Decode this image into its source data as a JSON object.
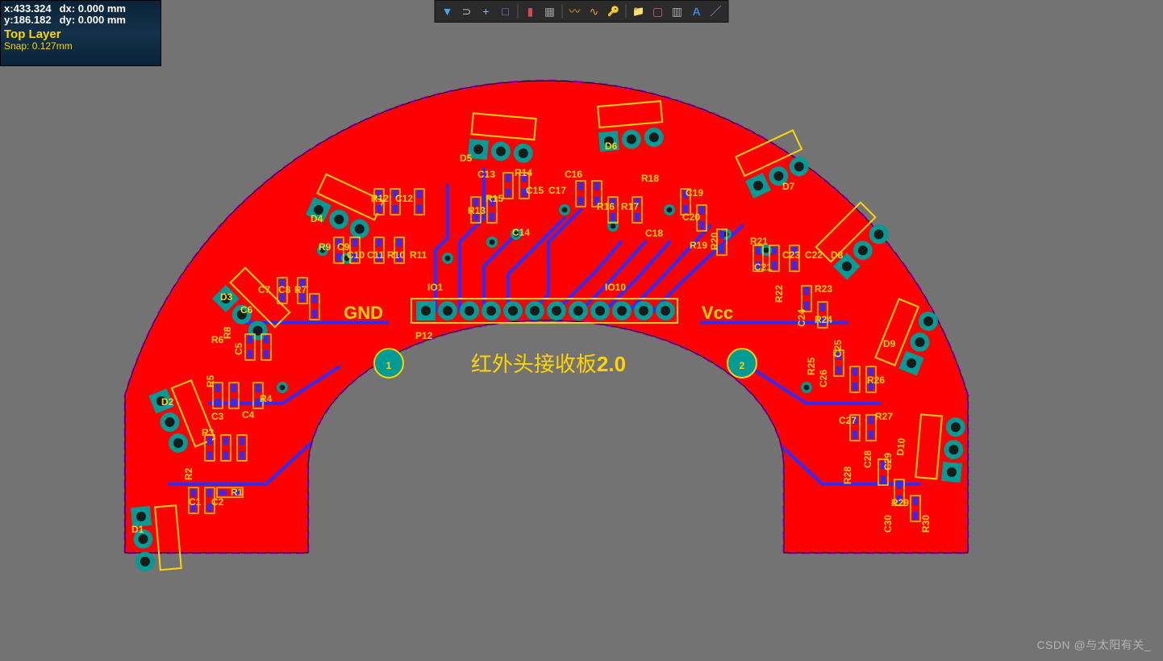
{
  "status": {
    "x_label": "x:",
    "x_val": "433.324",
    "dx_label": "dx:",
    "dx_val": "0.000 mm",
    "y_label": "y:",
    "y_val": "186.182",
    "dy_label": "dy:",
    "dy_val": "0.000 mm",
    "layer": "Top Layer",
    "snap": "Snap: 0.127mm"
  },
  "toolbar": {
    "filter": "▼",
    "snap_tool": "⊃",
    "crosshair": "+",
    "select_area": "□",
    "bars": "▮",
    "grid": "▦",
    "route": "〰",
    "route2": "∿",
    "key": "🔑",
    "flag": "📁",
    "box": "▢",
    "chart": "▥",
    "text": "A",
    "line": "／"
  },
  "board": {
    "gnd": "GND",
    "vcc": "Vcc",
    "io1": "IO1",
    "io10": "IO10",
    "connector": "P12",
    "title": "红外头接收板",
    "version": "2.0",
    "fiducial1": "1",
    "fiducial2": "2",
    "designators": {
      "D1": "D1",
      "D2": "D2",
      "D3": "D3",
      "D4": "D4",
      "D5": "D5",
      "D6": "D6",
      "D7": "D7",
      "D8": "D8",
      "D9": "D9",
      "D10": "D10",
      "C1": "C1",
      "C2": "C2",
      "C3": "C3",
      "C4": "C4",
      "C5": "C5",
      "C6": "C6",
      "C7": "C7",
      "C8": "C8",
      "C9": "C9",
      "C10": "C10",
      "C11": "C11",
      "C12": "C12",
      "C13": "C13",
      "C14": "C14",
      "C15": "C15",
      "C16": "C16",
      "C17": "C17",
      "C18": "C18",
      "C19": "C19",
      "C20": "C20",
      "C21": "C21",
      "C22": "C22",
      "C23": "C23",
      "C24": "C24",
      "C25": "C25",
      "C26": "C26",
      "C27": "C27",
      "C28": "C28",
      "C29": "C29",
      "C30": "C30",
      "R1": "R1",
      "R2": "R2",
      "R3": "R3",
      "R4": "R4",
      "R5": "R5",
      "R6": "R6",
      "R7": "R7",
      "R8": "R8",
      "R9": "R9",
      "R10": "R10",
      "R11": "R11",
      "R12": "R12",
      "R13": "R13",
      "R14": "R14",
      "R15": "R15",
      "R16": "R16",
      "R17": "R17",
      "R18": "R18",
      "R19": "R19",
      "R20": "R20",
      "R21": "R21",
      "R22": "R22",
      "R23": "R23",
      "R24": "R24",
      "R25": "R25",
      "R26": "R26",
      "R27": "R27",
      "R28": "R28",
      "R29": "R29",
      "R30": "R30"
    }
  },
  "watermark": "CSDN @与太阳有关_",
  "colors": {
    "copper": "#ff0000",
    "silk": "#ffd400",
    "trace": "#2d2dff",
    "outline": "#c800c8",
    "pad": "#009b94",
    "drill": "#202020",
    "bg": "#737373"
  }
}
